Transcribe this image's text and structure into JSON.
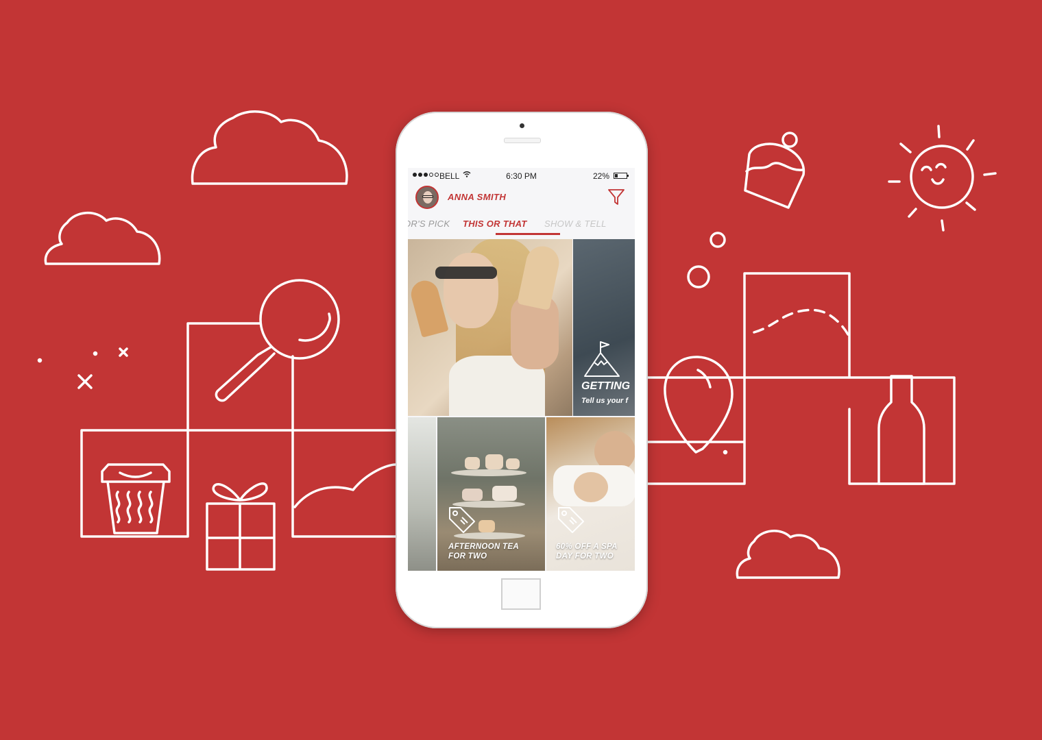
{
  "status_bar": {
    "carrier": "BELL",
    "time": "6:30 PM",
    "battery": "22%"
  },
  "profile": {
    "name": "ANNA SMITH"
  },
  "tabs": [
    {
      "label": "OR'S PICK",
      "active": false
    },
    {
      "label": "THIS OR THAT",
      "active": true
    },
    {
      "label": "SHOW & TELL",
      "active": false
    }
  ],
  "tiles": {
    "getting_started": {
      "title": "GETTING",
      "subtitle": "Tell us your f"
    },
    "afternoon_tea": {
      "line1": "AFTERNOON TEA",
      "line2": "FOR TWO"
    },
    "spa_day": {
      "line1": "60% OFF A SPA",
      "line2": "DAY FOR TWO"
    }
  },
  "colors": {
    "background": "#c23535",
    "accent": "#c23535",
    "line_art": "#ffffff"
  },
  "icons": {
    "filter": "filter-icon",
    "mountain_flag": "mountain-flag-icon",
    "price_tag": "price-tag-icon"
  }
}
